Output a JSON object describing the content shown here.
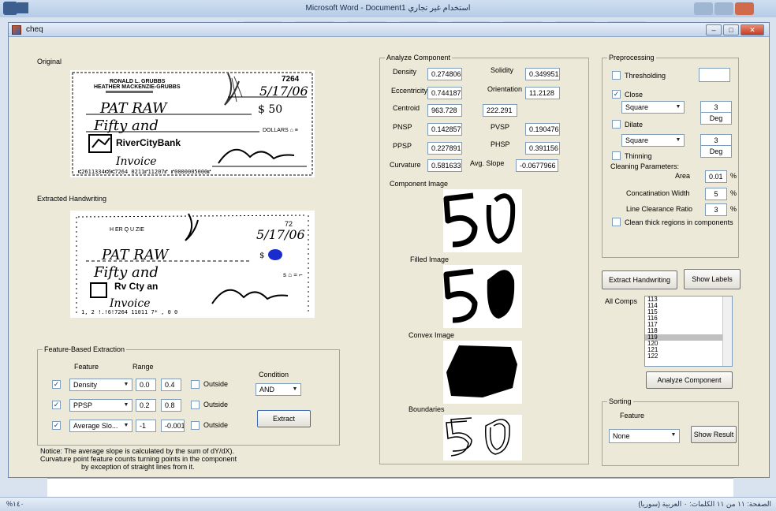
{
  "word": {
    "title": "Microsoft Word - Document1 استخدام غير تجاري",
    "status_left": "%١٤٠",
    "status_right": "الصفحة: ١١ من ١١   الكلمات: ٠   العربية (سوريا)"
  },
  "window": {
    "title": "cheq"
  },
  "labels": {
    "original": "Original",
    "extracted": "Extracted Handwriting",
    "component_image": "Component Image",
    "filled_image": "Filled Image",
    "convex_image": "Convex Image",
    "boundaries": "Boundaries"
  },
  "analyze": {
    "title": "Analyze Component",
    "density_label": "Density",
    "density": "0.274806",
    "solidity_label": "Solidity",
    "solidity": "0.349951",
    "eccentricity_label": "Eccentricity",
    "eccentricity": "0.744187",
    "orientation_label": "Orientation",
    "orientation": "11.2128",
    "centroid_label": "Centroid",
    "centroid_x": "963.728",
    "centroid_y": "222.291",
    "pnsp_label": "PNSP",
    "pnsp": "0.142857",
    "pvsp_label": "PVSP",
    "pvsp": "0.190476",
    "ppsp_label": "PPSP",
    "ppsp": "0.227891",
    "phsp_label": "PHSP",
    "phsp": "0.391156",
    "curvature_label": "Curvature",
    "curvature": "0.581633",
    "avgslope_label": "Avg. Slope",
    "avgslope": "-0.0677966"
  },
  "preprocessing": {
    "title": "Preprocessing",
    "thresholding": "Thresholding",
    "close": "Close",
    "close_shape": "Square",
    "close_size": "3",
    "close_unit": "Deg",
    "dilate": "Dilate",
    "dilate_shape": "Square",
    "dilate_size": "3",
    "dilate_unit": "Deg",
    "thinning": "Thinning",
    "cleaning": "Cleaning Parameters:",
    "area_label": "Area",
    "area": "0.01",
    "concat_label": "Concatination Width",
    "concat": "5",
    "lineclear_label": "Line Clearance Ratio",
    "lineclear": "3",
    "pct": "%",
    "clean_thick": "Clean thick regions in components"
  },
  "actions": {
    "extract_handwriting": "Extract Handwriting",
    "show_labels": "Show Labels",
    "all_comps": "All Comps",
    "comps": [
      "113",
      "114",
      "115",
      "116",
      "117",
      "118",
      "119",
      "120",
      "121",
      "122"
    ],
    "selected": "119",
    "analyze_component": "Analyze Component"
  },
  "sorting": {
    "title": "Sorting",
    "feature_label": "Feature",
    "feature": "None",
    "show_result": "Show Result"
  },
  "extraction": {
    "title": "Feature-Based Extraction",
    "feature_header": "Feature",
    "range_header": "Range",
    "condition_label": "Condition",
    "condition": "AND",
    "extract_btn": "Extract",
    "outside": "Outside",
    "rows": [
      {
        "feature": "Density",
        "min": "0.0",
        "max": "0.4"
      },
      {
        "feature": "PPSP",
        "min": "0.2",
        "max": "0.8"
      },
      {
        "feature": "Average Slo...",
        "min": "-1",
        "max": "-0.001"
      }
    ]
  },
  "notice": {
    "line1": "Notice: The average slope is calculated by the sum of dY/dX).",
    "line2": "Curvature point feature counts turning points in the component",
    "line3": "by exception of straight lines from it."
  },
  "check": {
    "name1": "RONALD L. GRUBBS",
    "name2": "HEATHER MACKENZIE-GRUBBS",
    "number": "7264",
    "date": "5/17/06",
    "payee": "PAT RAW",
    "amount": "$ 50",
    "words": "Fifty and",
    "bank": "RiverCityBank",
    "micr": "⑆2611334⑆6⑆7264 0211⑈11207⑈  ⑈0000005000⑈",
    "ext_number": "72",
    "ext_date": "5/17/06",
    "ext_payee": "PAT RAW",
    "ext_bank": "Rv Cty an",
    "ext_micr": "1, 2    !.!6!7264    11011  7*    ,  0        0"
  }
}
